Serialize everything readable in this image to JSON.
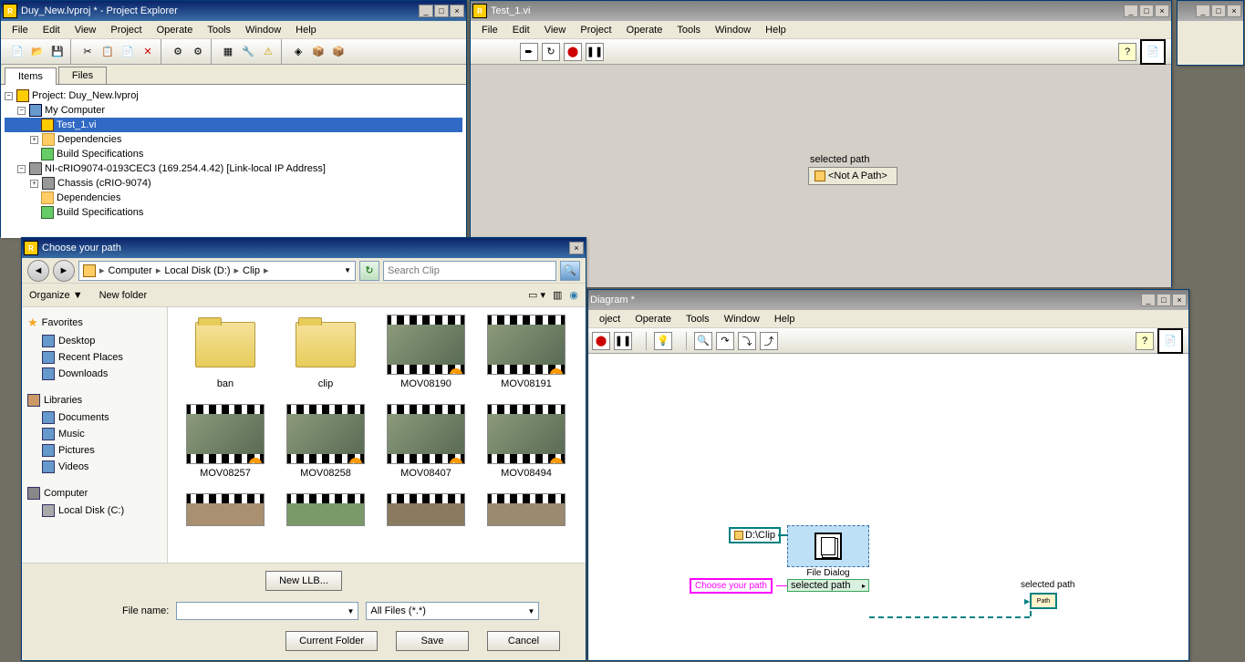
{
  "projExplorer": {
    "title": "Duy_New.lvproj * - Project Explorer",
    "tabs": {
      "items": "Items",
      "files": "Files"
    },
    "tree": {
      "root": "Project: Duy_New.lvproj",
      "myComputer": "My Computer",
      "test1": "Test_1.vi",
      "deps": "Dependencies",
      "builds": "Build Specifications",
      "crio": "NI-cRIO9074-0193CEC3 (169.254.4.42) [Link-local IP Address]",
      "chassis": "Chassis (cRIO-9074)"
    }
  },
  "menus": {
    "file": "File",
    "edit": "Edit",
    "view": "View",
    "project": "Project",
    "operate": "Operate",
    "tools": "Tools",
    "window": "Window",
    "help": "Help"
  },
  "viPanel": {
    "title": "Test_1.vi",
    "selLabel": "selected path",
    "selValue": "<Not A Path>"
  },
  "blockDiagram": {
    "title": "Diagram *",
    "menus": {
      "oject": "oject",
      "operate": "Operate",
      "tools": "Tools",
      "window": "Window",
      "help": "Help"
    },
    "pathConst": "D:\\Clip",
    "stringConst": "Choose your path",
    "nodeName": "File Dialog",
    "nodeOut": "selected path",
    "indLabel": "selected path"
  },
  "dialog": {
    "title": "Choose your path",
    "breadcrumb": {
      "computer": "Computer",
      "disk": "Local Disk (D:)",
      "folder": "Clip"
    },
    "searchPlaceholder": "Search Clip",
    "organize": "Organize",
    "newFolder": "New folder",
    "sidebar": {
      "favorites": "Favorites",
      "desktop": "Desktop",
      "recent": "Recent Places",
      "downloads": "Downloads",
      "libraries": "Libraries",
      "documents": "Documents",
      "music": "Music",
      "pictures": "Pictures",
      "videos": "Videos",
      "computer": "Computer",
      "localC": "Local Disk (C:)"
    },
    "items": [
      {
        "name": "ban",
        "type": "folder"
      },
      {
        "name": "clip",
        "type": "folder"
      },
      {
        "name": "MOV08190",
        "type": "video"
      },
      {
        "name": "MOV08191",
        "type": "video"
      },
      {
        "name": "MOV08257",
        "type": "video"
      },
      {
        "name": "MOV08258",
        "type": "video"
      },
      {
        "name": "MOV08407",
        "type": "video"
      },
      {
        "name": "MOV08494",
        "type": "video"
      }
    ],
    "newLLB": "New LLB...",
    "fileNameLabel": "File name:",
    "filter": "All Files (*.*)",
    "btnCurrent": "Current Folder",
    "btnSave": "Save",
    "btnCancel": "Cancel"
  }
}
